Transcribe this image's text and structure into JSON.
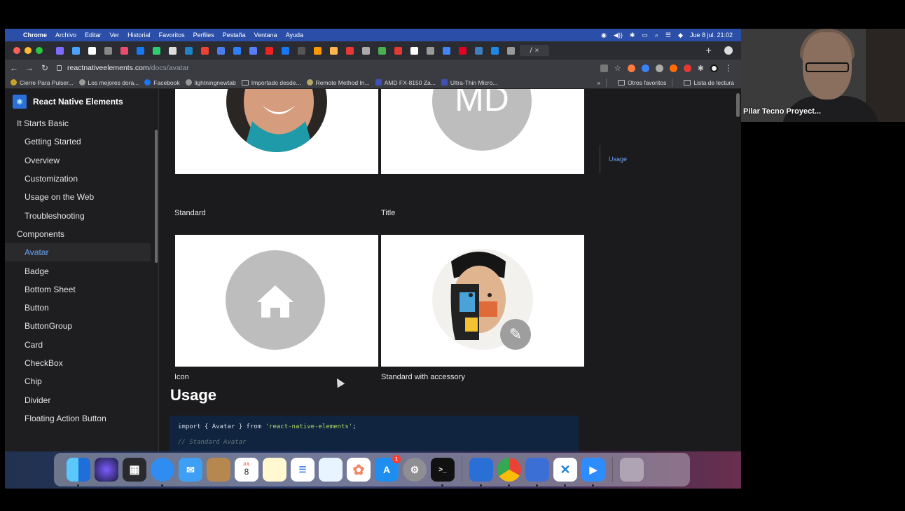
{
  "menubar": {
    "apple": "",
    "items": [
      "Chrome",
      "Archivo",
      "Editar",
      "Ver",
      "Historial",
      "Favoritos",
      "Perfiles",
      "Pestaña",
      "Ventana",
      "Ayuda"
    ],
    "clock": "Jue 8 jul.  21:02"
  },
  "browser": {
    "active_tab_label": "/",
    "tab_close": "×",
    "new_tab": "+",
    "url_host": "reactnativeelements.com",
    "url_path": "/docs/avatar"
  },
  "bookmarks": {
    "items": [
      "Cierre Para Pulser...",
      "Los mejores dora...",
      "Facebook",
      "lightningnewtab",
      "Importado desde...",
      "Remote Method In...",
      "AMD FX-8150 Za...",
      "Ultra-Thin Micro..."
    ],
    "overflow": "»",
    "other": "Otros favoritos",
    "reading_list": "Lista de lectura"
  },
  "sidebar": {
    "brand": "React Native Elements",
    "items": [
      {
        "label": "It Starts Basic",
        "kind": "cat"
      },
      {
        "label": "Getting Started",
        "kind": "item"
      },
      {
        "label": "Overview",
        "kind": "item"
      },
      {
        "label": "Customization",
        "kind": "item"
      },
      {
        "label": "Usage on the Web",
        "kind": "item"
      },
      {
        "label": "Troubleshooting",
        "kind": "item"
      },
      {
        "label": "Components",
        "kind": "cat"
      },
      {
        "label": "Avatar",
        "kind": "item",
        "active": true
      },
      {
        "label": "Badge",
        "kind": "item"
      },
      {
        "label": "Bottom Sheet",
        "kind": "item"
      },
      {
        "label": "Button",
        "kind": "item"
      },
      {
        "label": "ButtonGroup",
        "kind": "item"
      },
      {
        "label": "Card",
        "kind": "item"
      },
      {
        "label": "CheckBox",
        "kind": "item"
      },
      {
        "label": "Chip",
        "kind": "item"
      },
      {
        "label": "Divider",
        "kind": "item"
      },
      {
        "label": "Floating Action Button",
        "kind": "item"
      }
    ]
  },
  "content": {
    "cards": [
      {
        "caption": "Standard"
      },
      {
        "caption": "Title",
        "initials": "MD"
      },
      {
        "caption": "Icon"
      },
      {
        "caption": "Standard with accessory"
      }
    ],
    "usage_heading": "Usage",
    "code_line1_a": "import { Avatar } from ",
    "code_line1_b": "'react-native-elements'",
    "code_line1_c": ";",
    "code_line2": "// Standard Avatar"
  },
  "toc": {
    "item": "Usage"
  },
  "participant": {
    "name": "Pilar Tecno Proyect..."
  },
  "dock": {
    "calendar_month": "JUL",
    "calendar_day": "8",
    "appstore_badge": "1"
  },
  "colors": {
    "menubar": "#2b4fa8",
    "link_active": "#6aa4f5",
    "page_bg": "#1b1b1d",
    "code_bg": "#10243f"
  }
}
